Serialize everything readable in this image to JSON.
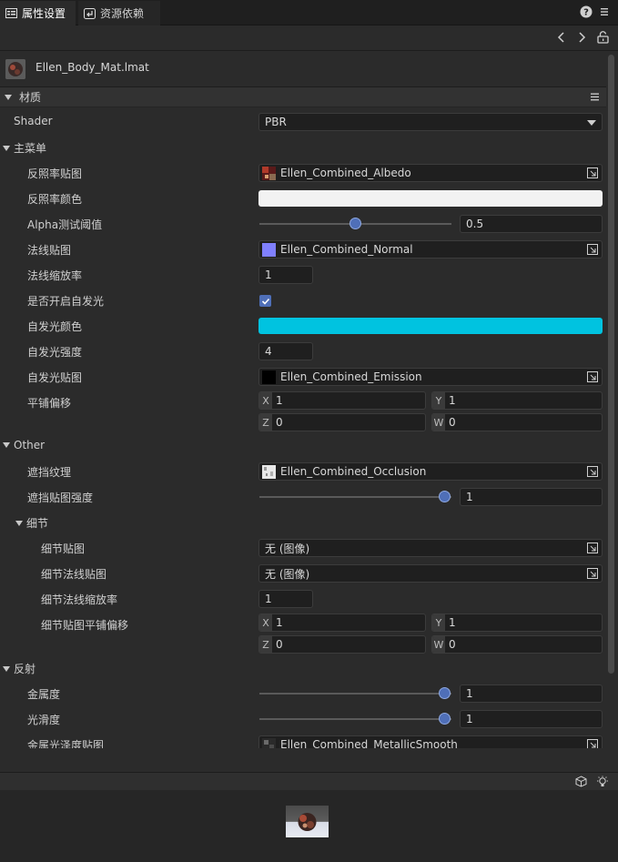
{
  "tabs": [
    {
      "label": "属性设置",
      "active": true
    },
    {
      "label": "资源依赖",
      "active": false
    }
  ],
  "asset": {
    "name": "Ellen_Body_Mat.lmat"
  },
  "section_material": {
    "label": "材质"
  },
  "shader": {
    "label": "Shader",
    "value": "PBR"
  },
  "group_main": {
    "label": "主菜单"
  },
  "props": {
    "albedo_tex": {
      "label": "反照率贴图",
      "value": "Ellen_Combined_Albedo"
    },
    "albedo_color": {
      "label": "反照率颜色",
      "color": "#f2f2f2"
    },
    "alpha_test": {
      "label": "Alpha测试阈值",
      "value": "0.5",
      "level": 0.5
    },
    "normal_tex": {
      "label": "法线贴图",
      "value": "Ellen_Combined_Normal"
    },
    "normal_scale": {
      "label": "法线缩放率",
      "value": "1"
    },
    "emission_on": {
      "label": "是否开启自发光",
      "checked": true
    },
    "emission_color": {
      "label": "自发光颜色",
      "color": "#00c3e0"
    },
    "emission_strength": {
      "label": "自发光强度",
      "value": "4"
    },
    "emission_tex": {
      "label": "自发光贴图",
      "value": "Ellen_Combined_Emission"
    },
    "tiling_offset": {
      "label": "平铺偏移",
      "x": "1",
      "y": "1",
      "z": "0",
      "w": "0"
    }
  },
  "group_other": {
    "label": "Other"
  },
  "other": {
    "occlusion_tex": {
      "label": "遮挡纹理",
      "value": "Ellen_Combined_Occlusion"
    },
    "occlusion_strength": {
      "label": "遮挡贴图强度",
      "value": "1",
      "level": 1.0
    }
  },
  "group_detail": {
    "label": "细节"
  },
  "detail": {
    "detail_tex": {
      "label": "细节贴图",
      "value": "无 (图像)"
    },
    "detail_normal_tex": {
      "label": "细节法线贴图",
      "value": "无 (图像)"
    },
    "detail_normal_scale": {
      "label": "细节法线缩放率",
      "value": "1"
    },
    "detail_tiling": {
      "label": "细节贴图平铺偏移",
      "x": "1",
      "y": "1",
      "z": "0",
      "w": "0"
    }
  },
  "group_reflect": {
    "label": "反射"
  },
  "reflect": {
    "metallic": {
      "label": "金属度",
      "value": "1",
      "level": 1.0
    },
    "smoothness": {
      "label": "光滑度",
      "value": "1",
      "level": 1.0
    },
    "metal_smooth_tex": {
      "label": "金属光泽度贴图",
      "value": "Ellen_Combined_MetallicSmooth"
    }
  },
  "axis": {
    "x": "X",
    "y": "Y",
    "z": "Z",
    "w": "W"
  },
  "colors": {
    "accent": "#4f6fb8",
    "emission": "#00c3e0",
    "normal_swatch": "#8080ff"
  },
  "icons": [
    "properties-icon",
    "dependency-icon",
    "help-icon",
    "menu-icon",
    "back-icon",
    "forward-icon",
    "unlock-icon",
    "picker-icon",
    "cube-icon",
    "light-icon"
  ]
}
